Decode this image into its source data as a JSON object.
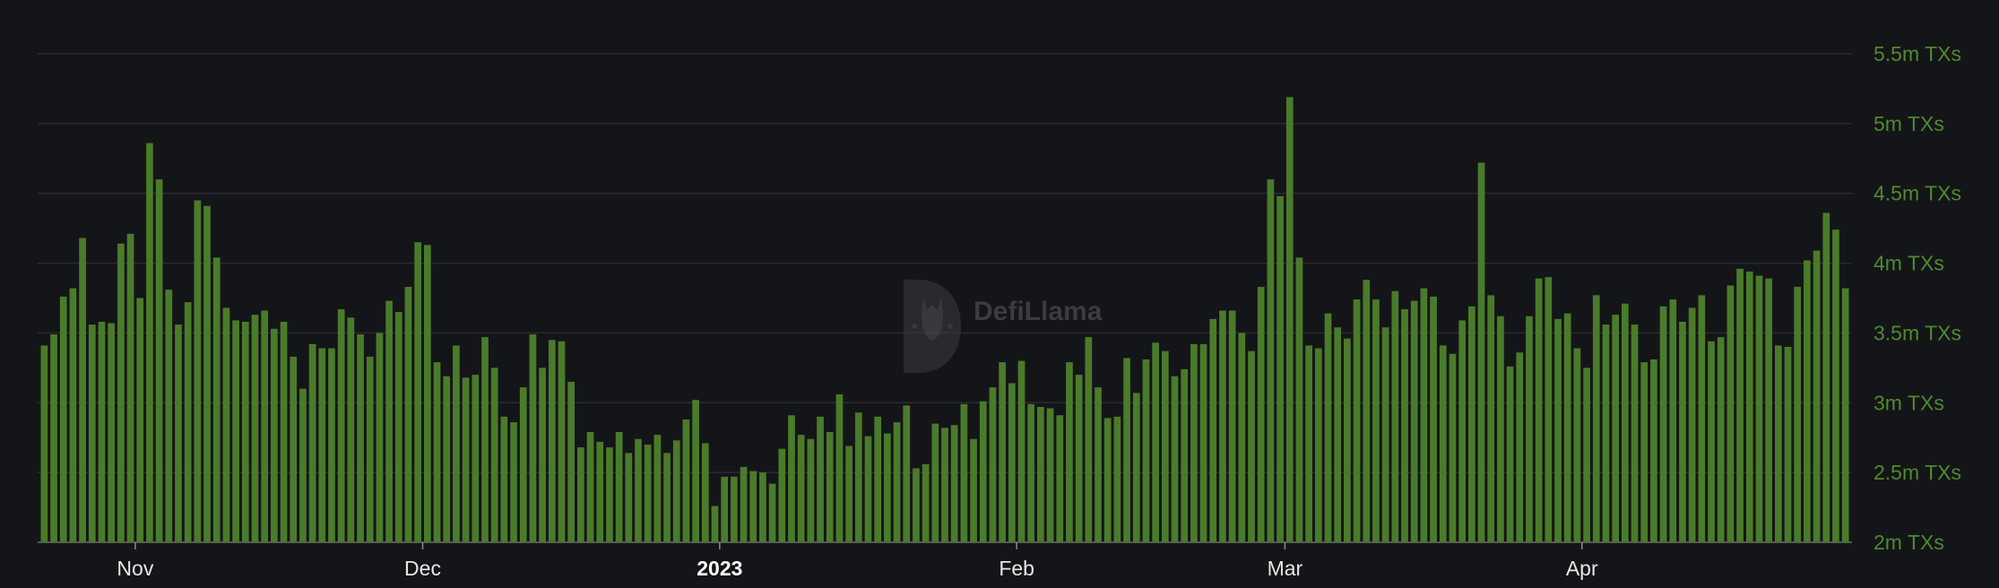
{
  "chart_data": {
    "type": "bar",
    "ylabel": "",
    "xlabel": "",
    "ylim": [
      2.0,
      5.75
    ],
    "grid": true,
    "bar_color": "#4a7b2a",
    "grid_color": "#2a2b30",
    "background": "#141518",
    "y_ticks": [
      {
        "value": 2.0,
        "label": "2m TXs"
      },
      {
        "value": 2.5,
        "label": "2.5m TXs"
      },
      {
        "value": 3.0,
        "label": "3m TXs"
      },
      {
        "value": 3.5,
        "label": "3.5m TXs"
      },
      {
        "value": 4.0,
        "label": "4m TXs"
      },
      {
        "value": 4.5,
        "label": "4.5m TXs"
      },
      {
        "value": 5.0,
        "label": "5m TXs"
      },
      {
        "value": 5.5,
        "label": "5.5m TXs"
      }
    ],
    "x_ticks": [
      {
        "index": 10,
        "label": "Nov",
        "bold": false
      },
      {
        "index": 40,
        "label": "Dec",
        "bold": false
      },
      {
        "index": 71,
        "label": "2023",
        "bold": true
      },
      {
        "index": 102,
        "label": "Feb",
        "bold": false
      },
      {
        "index": 130,
        "label": "Mar",
        "bold": false
      },
      {
        "index": 161,
        "label": "Apr",
        "bold": false
      }
    ],
    "values": [
      3.41,
      3.49,
      3.76,
      3.82,
      4.18,
      3.56,
      3.58,
      3.57,
      4.14,
      4.21,
      3.75,
      4.86,
      4.6,
      3.81,
      3.56,
      3.72,
      4.45,
      4.41,
      4.04,
      3.68,
      3.59,
      3.58,
      3.63,
      3.66,
      3.53,
      3.58,
      3.33,
      3.1,
      3.42,
      3.39,
      3.39,
      3.67,
      3.61,
      3.49,
      3.33,
      3.5,
      3.73,
      3.65,
      3.83,
      4.15,
      4.13,
      3.29,
      3.19,
      3.41,
      3.18,
      3.2,
      3.47,
      3.25,
      2.9,
      2.86,
      3.11,
      3.49,
      3.25,
      3.45,
      3.44,
      3.15,
      2.68,
      2.79,
      2.72,
      2.68,
      2.79,
      2.64,
      2.74,
      2.7,
      2.77,
      2.64,
      2.73,
      2.88,
      3.02,
      2.71,
      2.26,
      2.47,
      2.47,
      2.54,
      2.51,
      2.5,
      2.42,
      2.67,
      2.91,
      2.77,
      2.74,
      2.9,
      2.79,
      3.06,
      2.69,
      2.93,
      2.76,
      2.9,
      2.78,
      2.86,
      2.98,
      2.53,
      2.56,
      2.85,
      2.82,
      2.84,
      2.99,
      2.74,
      3.01,
      3.11,
      3.29,
      3.14,
      3.3,
      2.99,
      2.97,
      2.96,
      2.91,
      3.29,
      3.2,
      3.47,
      3.11,
      2.89,
      2.9,
      3.32,
      3.07,
      3.31,
      3.43,
      3.37,
      3.19,
      3.24,
      3.42,
      3.42,
      3.6,
      3.66,
      3.66,
      3.5,
      3.37,
      3.83,
      4.6,
      4.48,
      5.19,
      4.04,
      3.41,
      3.39,
      3.64,
      3.54,
      3.46,
      3.74,
      3.88,
      3.74,
      3.54,
      3.8,
      3.67,
      3.73,
      3.82,
      3.76,
      3.41,
      3.35,
      3.59,
      3.69,
      4.72,
      3.77,
      3.62,
      3.26,
      3.36,
      3.62,
      3.89,
      3.9,
      3.6,
      3.64,
      3.39,
      3.25,
      3.77,
      3.56,
      3.63,
      3.71,
      3.56,
      3.29,
      3.31,
      3.69,
      3.74,
      3.58,
      3.68,
      3.77,
      3.44,
      3.47,
      3.84,
      3.96,
      3.94,
      3.91,
      3.89,
      3.41,
      3.4,
      3.83,
      4.02,
      4.09,
      4.36,
      4.24,
      3.82
    ]
  },
  "watermark": {
    "brand": "DefiLlama"
  }
}
